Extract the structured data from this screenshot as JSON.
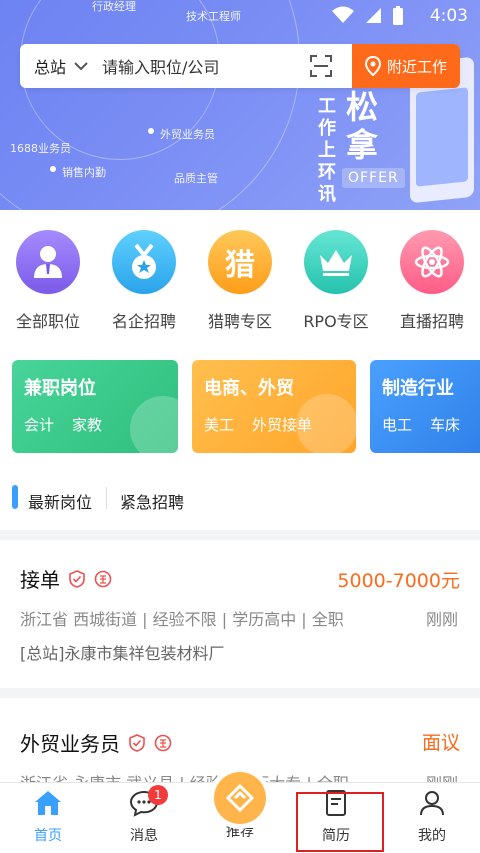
{
  "status_bar": {
    "time": "4:03"
  },
  "banner": {
    "floating_words": [
      "行政经理",
      "技术工程师",
      "外贸业务员",
      "1688业务员",
      "销售内勤",
      "品质主管"
    ],
    "poster_vertical_text": "工作上环讯",
    "poster_big_text": "松拿",
    "offer_label": "OFFER"
  },
  "search": {
    "city": "总站",
    "placeholder": "请输入职位/公司",
    "nearby_label": "附近工作"
  },
  "categories": [
    {
      "label": "全部职位",
      "icon": "person-icon",
      "color": "#8a6cf0"
    },
    {
      "label": "名企招聘",
      "icon": "medal-icon",
      "color": "#39b6f0"
    },
    {
      "label": "猎聘专区",
      "icon": "hunt-icon",
      "glyph": "猎",
      "color": "#ffaa2e"
    },
    {
      "label": "RPO专区",
      "icon": "crown-icon",
      "color": "#3bd3c0"
    },
    {
      "label": "直播招聘",
      "icon": "atom-icon",
      "color": "#ff6f8f"
    }
  ],
  "cards": [
    {
      "title": "兼职岗位",
      "tags": [
        "会计",
        "家教"
      ],
      "color": "#3bc98a"
    },
    {
      "title": "电商、外贸",
      "tags": [
        "美工",
        "外贸接单"
      ],
      "color": "#ffb03a"
    },
    {
      "title": "制造行业",
      "tags": [
        "电工",
        "车床"
      ],
      "color": "#3b8cf0"
    }
  ],
  "tabs": {
    "latest": "最新岗位",
    "urgent": "紧急招聘"
  },
  "jobs": [
    {
      "title": "接单",
      "salary": "5000-7000元",
      "meta": "浙江省 西城街道 | 经验不限 | 学历高中 | 全职",
      "time": "刚刚",
      "company": "[总站]永康市集祥包装材料厂"
    },
    {
      "title": "外贸业务员",
      "salary": "面议",
      "meta": "浙江省 永康市 武义县 | 经验 | 学历大专 | 全职",
      "time": "刚刚"
    }
  ],
  "bottom_nav": {
    "home": "首页",
    "messages": "消息",
    "message_count": "1",
    "recommend": "推荐",
    "resume": "简历",
    "mine": "我的"
  }
}
